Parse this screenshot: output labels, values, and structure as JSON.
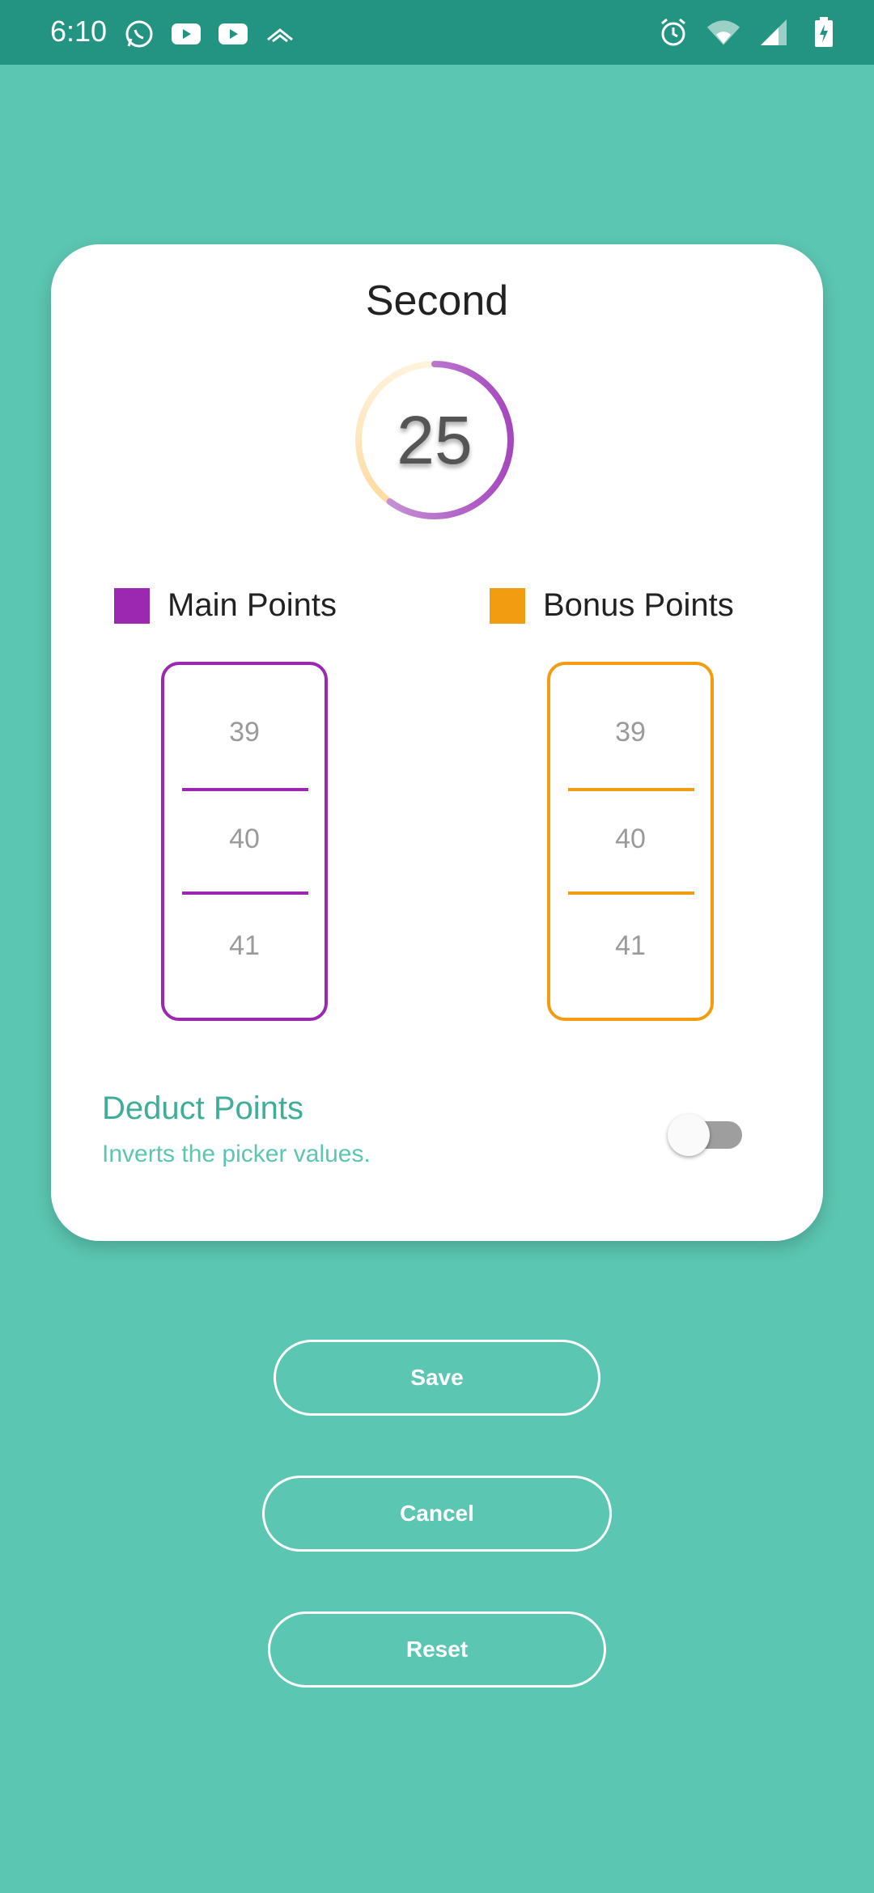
{
  "status_bar": {
    "time": "6:10",
    "left_icons": [
      "whatsapp-icon",
      "youtube-icon",
      "youtube-icon",
      "cast-icon"
    ],
    "right_icons": [
      "alarm-icon",
      "wifi-icon",
      "signal-icon",
      "battery-charging-icon"
    ]
  },
  "card": {
    "title": "Second",
    "score": "25",
    "score_ring_fraction": 0.6,
    "legends": {
      "main": {
        "label": "Main Points",
        "color": "#9C27B0"
      },
      "bonus": {
        "label": "Bonus Points",
        "color": "#F29C11"
      }
    },
    "pickers": {
      "main": {
        "values": [
          "39",
          "40",
          "41"
        ],
        "selected": "40"
      },
      "bonus": {
        "values": [
          "39",
          "40",
          "41"
        ],
        "selected": "40"
      }
    },
    "deduct": {
      "title": "Deduct Points",
      "subtitle": "Inverts the picker values.",
      "enabled": false
    }
  },
  "buttons": {
    "save": "Save",
    "cancel": "Cancel",
    "reset": "Reset"
  },
  "colors": {
    "background": "#5BC6B1",
    "status_bar": "#249482",
    "accent_text": "#3FAE99"
  }
}
